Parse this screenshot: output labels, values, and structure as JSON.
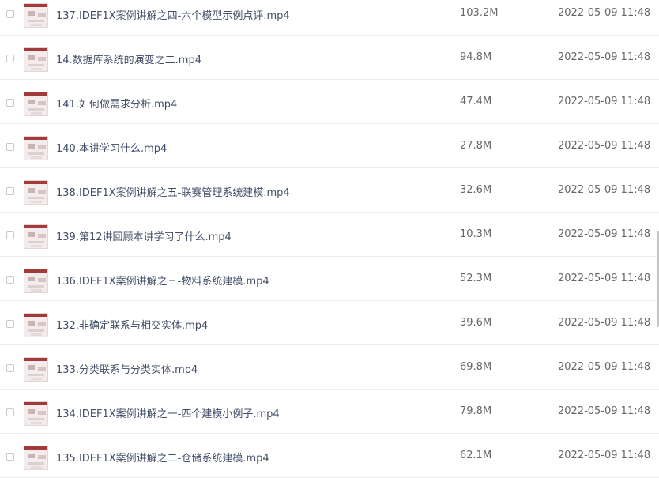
{
  "files": [
    {
      "name": "137.IDEF1X案例讲解之四-六个模型示例点评.mp4",
      "size": "103.2M",
      "date": "2022-05-09 11:48"
    },
    {
      "name": "14.数据库系统的演变之二.mp4",
      "size": "94.8M",
      "date": "2022-05-09 11:48"
    },
    {
      "name": "141.如何做需求分析.mp4",
      "size": "47.4M",
      "date": "2022-05-09 11:48"
    },
    {
      "name": "140.本讲学习什么.mp4",
      "size": "27.8M",
      "date": "2022-05-09 11:48"
    },
    {
      "name": "138.IDEF1X案例讲解之五-联赛管理系统建模.mp4",
      "size": "32.6M",
      "date": "2022-05-09 11:48"
    },
    {
      "name": "139.第12讲回顾本讲学习了什么.mp4",
      "size": "10.3M",
      "date": "2022-05-09 11:48"
    },
    {
      "name": "136.IDEF1X案例讲解之三-物料系统建模.mp4",
      "size": "52.3M",
      "date": "2022-05-09 11:48"
    },
    {
      "name": "132.非确定联系与相交实体.mp4",
      "size": "39.6M",
      "date": "2022-05-09 11:48"
    },
    {
      "name": "133.分类联系与分类实体.mp4",
      "size": "69.8M",
      "date": "2022-05-09 11:48"
    },
    {
      "name": "134.IDEF1X案例讲解之一-四个建模小例子.mp4",
      "size": "79.8M",
      "date": "2022-05-09 11:48"
    },
    {
      "name": "135.IDEF1X案例讲解之二-仓储系统建模.mp4",
      "size": "62.1M",
      "date": "2022-05-09 11:48"
    }
  ]
}
